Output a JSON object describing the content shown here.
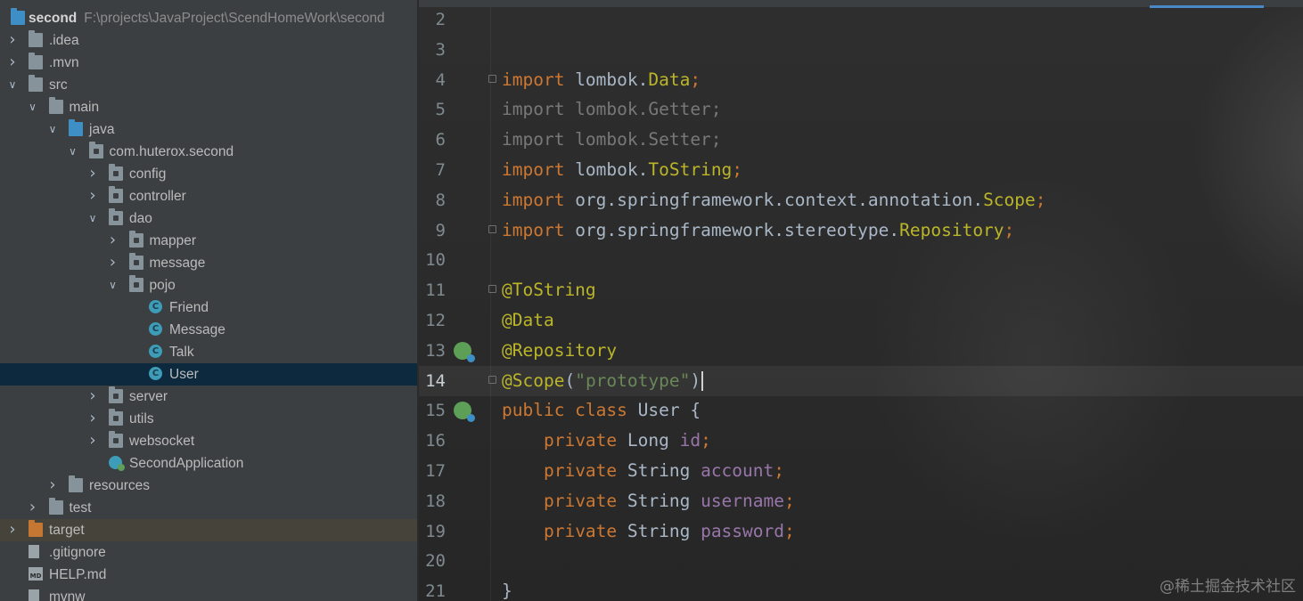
{
  "project_tree": {
    "root": {
      "name": "second",
      "path": "F:\\projects\\JavaProject\\ScendHomeWork\\second"
    },
    "items": [
      {
        "label": ".idea",
        "depth": 1,
        "arrow": "right",
        "icon": "folder-icon"
      },
      {
        "label": ".mvn",
        "depth": 1,
        "arrow": "right",
        "icon": "folder-icon"
      },
      {
        "label": "src",
        "depth": 1,
        "arrow": "down",
        "icon": "folder-icon"
      },
      {
        "label": "main",
        "depth": 2,
        "arrow": "down",
        "icon": "folder-icon"
      },
      {
        "label": "java",
        "depth": 3,
        "arrow": "down",
        "icon": "source-folder-icon"
      },
      {
        "label": "com.huterox.second",
        "depth": 4,
        "arrow": "down",
        "icon": "package-icon"
      },
      {
        "label": "config",
        "depth": 5,
        "arrow": "right",
        "icon": "package-icon"
      },
      {
        "label": "controller",
        "depth": 5,
        "arrow": "right",
        "icon": "package-icon"
      },
      {
        "label": "dao",
        "depth": 5,
        "arrow": "down",
        "icon": "package-icon"
      },
      {
        "label": "mapper",
        "depth": 6,
        "arrow": "right",
        "icon": "package-icon"
      },
      {
        "label": "message",
        "depth": 6,
        "arrow": "right",
        "icon": "package-icon"
      },
      {
        "label": "pojo",
        "depth": 6,
        "arrow": "down",
        "icon": "package-icon"
      },
      {
        "label": "Friend",
        "depth": 7,
        "arrow": "",
        "icon": "class-icon"
      },
      {
        "label": "Message",
        "depth": 7,
        "arrow": "",
        "icon": "class-icon"
      },
      {
        "label": "Talk",
        "depth": 7,
        "arrow": "",
        "icon": "class-icon"
      },
      {
        "label": "User",
        "depth": 7,
        "arrow": "",
        "icon": "class-icon",
        "selected": true
      },
      {
        "label": "server",
        "depth": 5,
        "arrow": "right",
        "icon": "package-icon"
      },
      {
        "label": "utils",
        "depth": 5,
        "arrow": "right",
        "icon": "package-icon"
      },
      {
        "label": "websocket",
        "depth": 5,
        "arrow": "right",
        "icon": "package-icon"
      },
      {
        "label": "SecondApplication",
        "depth": 5,
        "arrow": "",
        "icon": "spring-boot-app-icon"
      },
      {
        "label": "resources",
        "depth": 3,
        "arrow": "right",
        "icon": "resources-folder-icon"
      },
      {
        "label": "test",
        "depth": 2,
        "arrow": "right",
        "icon": "folder-icon"
      },
      {
        "label": "target",
        "depth": 1,
        "arrow": "right",
        "icon": "excluded-folder-icon",
        "excluded": true
      },
      {
        "label": ".gitignore",
        "depth": 1,
        "arrow": "",
        "icon": "file-icon"
      },
      {
        "label": "HELP.md",
        "depth": 1,
        "arrow": "",
        "icon": "markdown-file-icon"
      },
      {
        "label": "mvnw",
        "depth": 1,
        "arrow": "",
        "icon": "file-icon"
      }
    ]
  },
  "editor": {
    "current_line": 14,
    "lines": [
      {
        "num": "2",
        "tokens": []
      },
      {
        "num": "3",
        "tokens": []
      },
      {
        "num": "4",
        "fold": true,
        "tokens": [
          [
            "kw",
            "import"
          ],
          [
            "txt",
            " lombok."
          ],
          [
            "cls",
            "Data"
          ],
          [
            "kw",
            ";"
          ]
        ]
      },
      {
        "num": "5",
        "tokens": [
          [
            "dim",
            "import lombok.Getter;"
          ]
        ]
      },
      {
        "num": "6",
        "tokens": [
          [
            "dim",
            "import lombok.Setter;"
          ]
        ]
      },
      {
        "num": "7",
        "tokens": [
          [
            "kw",
            "import"
          ],
          [
            "txt",
            " lombok."
          ],
          [
            "cls",
            "ToString"
          ],
          [
            "kw",
            ";"
          ]
        ]
      },
      {
        "num": "8",
        "tokens": [
          [
            "kw",
            "import"
          ],
          [
            "txt",
            " org.springframework.context.annotation."
          ],
          [
            "cls",
            "Scope"
          ],
          [
            "kw",
            ";"
          ]
        ]
      },
      {
        "num": "9",
        "fold": true,
        "tokens": [
          [
            "kw",
            "import"
          ],
          [
            "txt",
            " org.springframework.stereotype."
          ],
          [
            "cls",
            "Repository"
          ],
          [
            "kw",
            ";"
          ]
        ]
      },
      {
        "num": "10",
        "tokens": []
      },
      {
        "num": "11",
        "fold": true,
        "tokens": [
          [
            "ann",
            "@ToString"
          ]
        ]
      },
      {
        "num": "12",
        "tokens": [
          [
            "ann",
            "@Data"
          ]
        ]
      },
      {
        "num": "13",
        "gutter_icon": "spring-bean-icon",
        "tokens": [
          [
            "ann",
            "@Repository"
          ]
        ]
      },
      {
        "num": "14",
        "fold": true,
        "caret": true,
        "tokens": [
          [
            "ann",
            "@Scope"
          ],
          [
            "txt",
            "("
          ],
          [
            "str",
            "\"prototype\""
          ],
          [
            "txt",
            ")"
          ]
        ]
      },
      {
        "num": "15",
        "gutter_icon": "spring-bean-icon",
        "tokens": [
          [
            "kw",
            "public class"
          ],
          [
            "txt",
            " User {"
          ]
        ]
      },
      {
        "num": "16",
        "tokens": [
          [
            "txt",
            "    "
          ],
          [
            "kw",
            "private"
          ],
          [
            "txt",
            " Long "
          ],
          [
            "fld",
            "id"
          ],
          [
            "kw",
            ";"
          ]
        ]
      },
      {
        "num": "17",
        "tokens": [
          [
            "txt",
            "    "
          ],
          [
            "kw",
            "private"
          ],
          [
            "txt",
            " String "
          ],
          [
            "fld",
            "account"
          ],
          [
            "kw",
            ";"
          ]
        ]
      },
      {
        "num": "18",
        "tokens": [
          [
            "txt",
            "    "
          ],
          [
            "kw",
            "private"
          ],
          [
            "txt",
            " String "
          ],
          [
            "fld",
            "username"
          ],
          [
            "kw",
            ";"
          ]
        ]
      },
      {
        "num": "19",
        "tokens": [
          [
            "txt",
            "    "
          ],
          [
            "kw",
            "private"
          ],
          [
            "txt",
            " String "
          ],
          [
            "fld",
            "password"
          ],
          [
            "kw",
            ";"
          ]
        ]
      },
      {
        "num": "20",
        "tokens": []
      },
      {
        "num": "21",
        "tokens": [
          [
            "txt",
            "}"
          ]
        ]
      }
    ]
  },
  "watermark": "@稀土掘金技术社区",
  "colors": {
    "keyword": "#cc7832",
    "annotation": "#bbb529",
    "string": "#6a8759",
    "field": "#9876aa",
    "text": "#a9b7c6",
    "selection": "#0d293e"
  }
}
